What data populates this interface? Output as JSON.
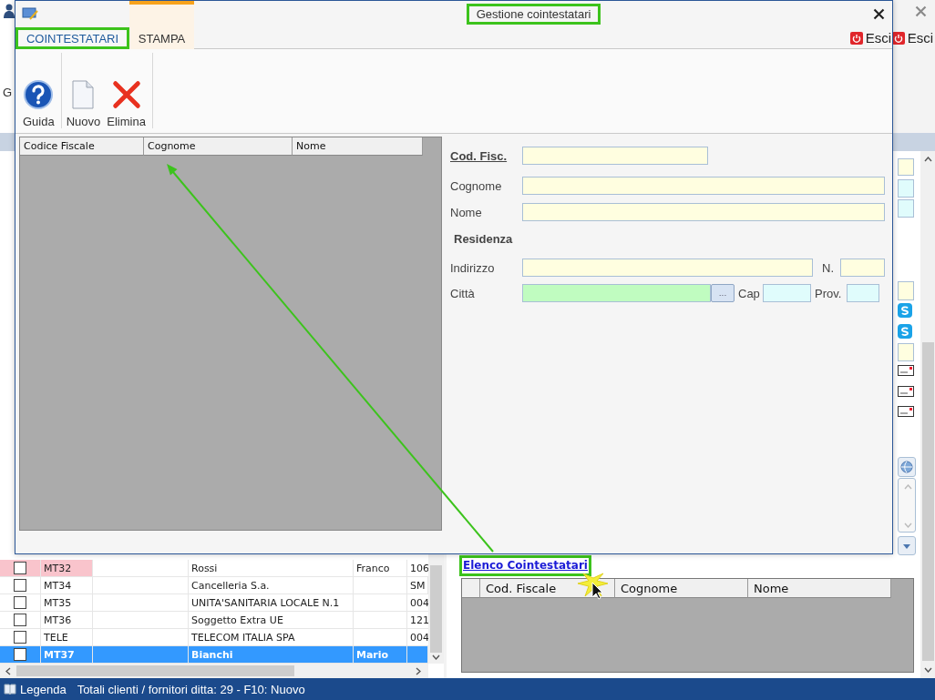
{
  "background": {
    "ribbon": {
      "partial_label": "G"
    },
    "exit_button": "Esci",
    "table": {
      "rows": [
        {
          "code": "MT32",
          "name": "Rossi",
          "first_name": "Franco",
          "column_6": "106",
          "flagged": true,
          "selected": false,
          "checked": false
        },
        {
          "code": "MT34",
          "name": "Cancelleria S.a.",
          "column_6": "SM",
          "flagged": false,
          "selected": false,
          "checked": false
        },
        {
          "code": "MT35",
          "name": "UNITA'SANITARIA LOCALE N.1",
          "column_6": "004",
          "flagged": false,
          "selected": false,
          "checked": false
        },
        {
          "code": "MT36",
          "name": "Soggetto Extra UE",
          "column_6": "121",
          "flagged": false,
          "selected": false,
          "checked": false
        },
        {
          "code": "TELE",
          "name": "TELECOM ITALIA SPA",
          "column_6": "004",
          "flagged": false,
          "selected": false,
          "checked": false
        },
        {
          "code": "MT37",
          "name": "Bianchi",
          "first_name": "Mario",
          "flagged": false,
          "selected": true,
          "checked": false
        }
      ]
    },
    "cointestatari": {
      "link": {
        "label": "Elenco Cointestatari",
        "highlighted": true
      },
      "columns": [
        "Cod. Fiscale",
        "Cognome",
        "Nome"
      ]
    }
  },
  "dialog": {
    "title": {
      "text": "Gestione cointestatari",
      "highlighted": true
    },
    "tabs": [
      {
        "label": "COINTESTATARI",
        "selected": true,
        "highlighted": true,
        "contextual": false
      },
      {
        "label": "STAMPA",
        "selected": false,
        "highlighted": false,
        "contextual": true
      }
    ],
    "exit_button": "Esci",
    "toolbar_groups": [
      {
        "buttons": [
          {
            "label": "Guida",
            "kind": "help"
          }
        ]
      },
      {
        "buttons": [
          {
            "label": "Nuovo",
            "kind": "new"
          },
          {
            "label": "Elimina",
            "kind": "delete"
          }
        ]
      }
    ],
    "grid": {
      "columns": [
        "Codice Fiscale",
        "Cognome",
        "Nome"
      ]
    },
    "form": {
      "fiscal_code": {
        "label": "Cod. Fisc.",
        "color": "#fffee0"
      },
      "surname": {
        "label": "Cognome",
        "color": "#fffee0"
      },
      "name": {
        "label": "Nome",
        "color": "#fffee0"
      },
      "section": "Residenza",
      "address": {
        "label": "Indirizzo",
        "color": "#fffee0"
      },
      "number": {
        "label": "N.",
        "color": "#fffee0"
      },
      "city": {
        "label": "Città",
        "color": "#c0fcc0",
        "button": "..."
      },
      "zip": {
        "label": "Cap",
        "color": "#e0fcfc"
      },
      "province": {
        "label": "Prov.",
        "color": "#e0fcfc"
      }
    }
  },
  "status_bar": {
    "legend": "Legenda",
    "summary": "Totali clienti / fornitori ditta: 29 - F10: Nuovo"
  }
}
